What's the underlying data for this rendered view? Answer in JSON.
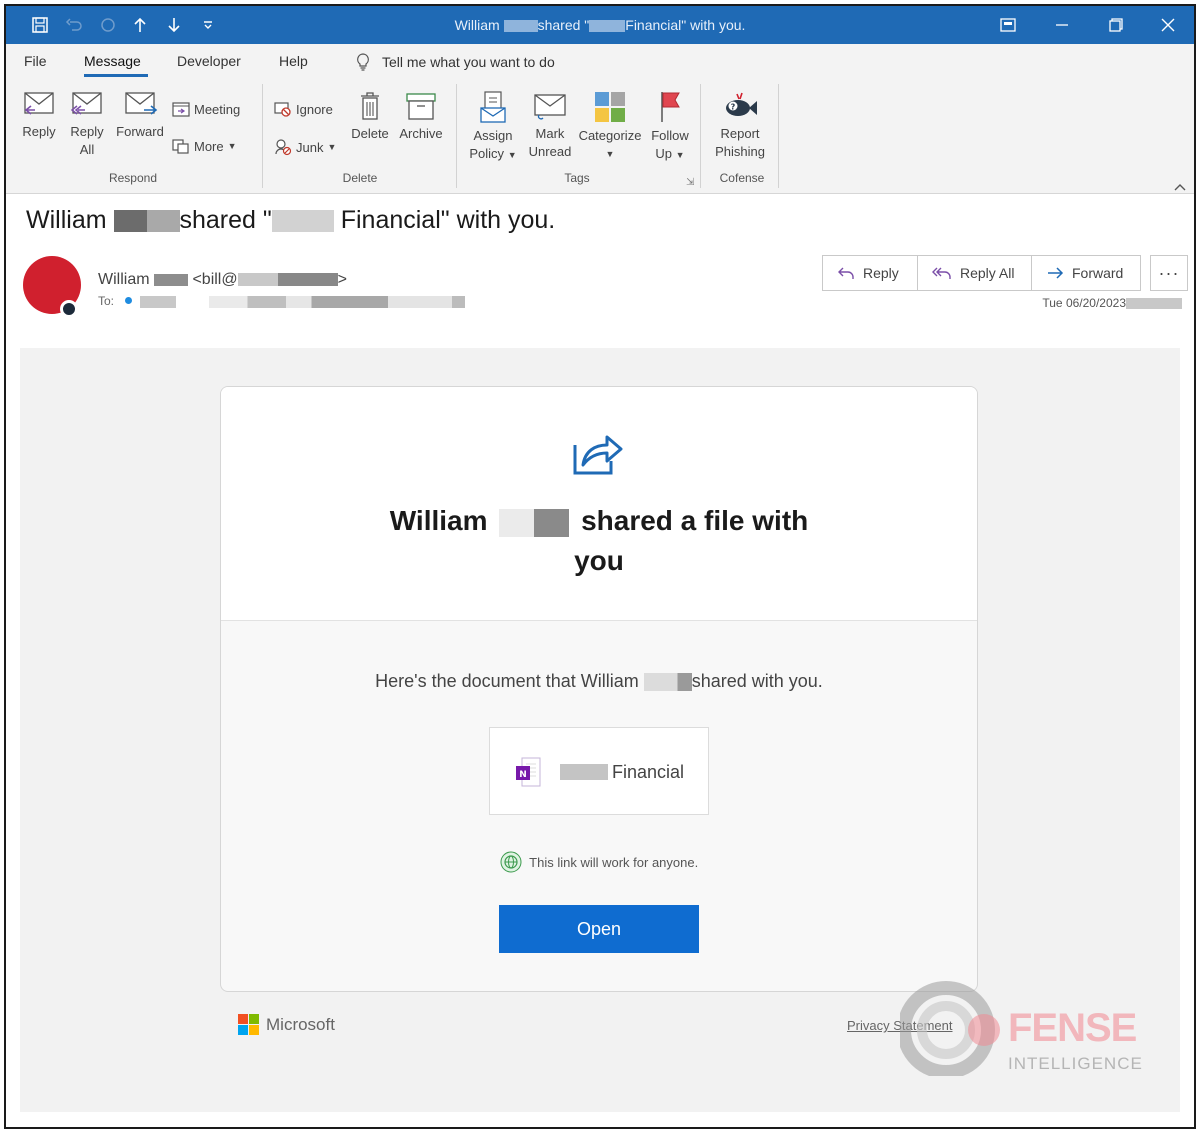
{
  "titlebar": {
    "title_prefix": "William",
    "title_mid": "shared \"",
    "title_suffix": "Financial\" with you."
  },
  "menu": {
    "items": [
      "File",
      "Message",
      "Developer",
      "Help"
    ],
    "tell_me": "Tell me what you want to do"
  },
  "ribbon": {
    "reply": "Reply",
    "reply_all_1": "Reply",
    "reply_all_2": "All",
    "forward": "Forward",
    "meeting": "Meeting",
    "more": "More",
    "ignore": "Ignore",
    "junk": "Junk",
    "delete": "Delete",
    "archive": "Archive",
    "assign_1": "Assign",
    "assign_2": "Policy",
    "mark_1": "Mark",
    "mark_2": "Unread",
    "categorize": "Categorize",
    "follow_1": "Follow",
    "follow_2": "Up",
    "report_1": "Report",
    "report_2": "Phishing",
    "groups": [
      "Respond",
      "Delete",
      "Tags",
      "Cofense"
    ]
  },
  "email": {
    "subject_prefix": "William",
    "subject_mid": "shared \"",
    "subject_suffix": "Financial\" with you.",
    "sender_name": "William",
    "sender_email_prefix": "<bill@",
    "sender_email_suffix": ">",
    "to_label": "To:",
    "reply": "Reply",
    "reply_all": "Reply All",
    "forward": "Forward",
    "date": "Tue 06/20/2023"
  },
  "card": {
    "headline_name": "William",
    "headline_rest_1": "shared a file with",
    "headline_rest_2": "you",
    "desc_prefix": "Here's the document that William",
    "desc_suffix": "shared with you.",
    "file_name": "Financial",
    "link_note": "This link will work for anyone.",
    "open_button": "Open",
    "microsoft": "Microsoft",
    "privacy": "Privacy Statement"
  },
  "watermark": {
    "brand": "FENSE",
    "sub": "INTELLIGENCE"
  },
  "colors": {
    "titlebar": "#1f6ab5",
    "open_button": "#0f6cd0",
    "avatar": "#d0202e"
  }
}
